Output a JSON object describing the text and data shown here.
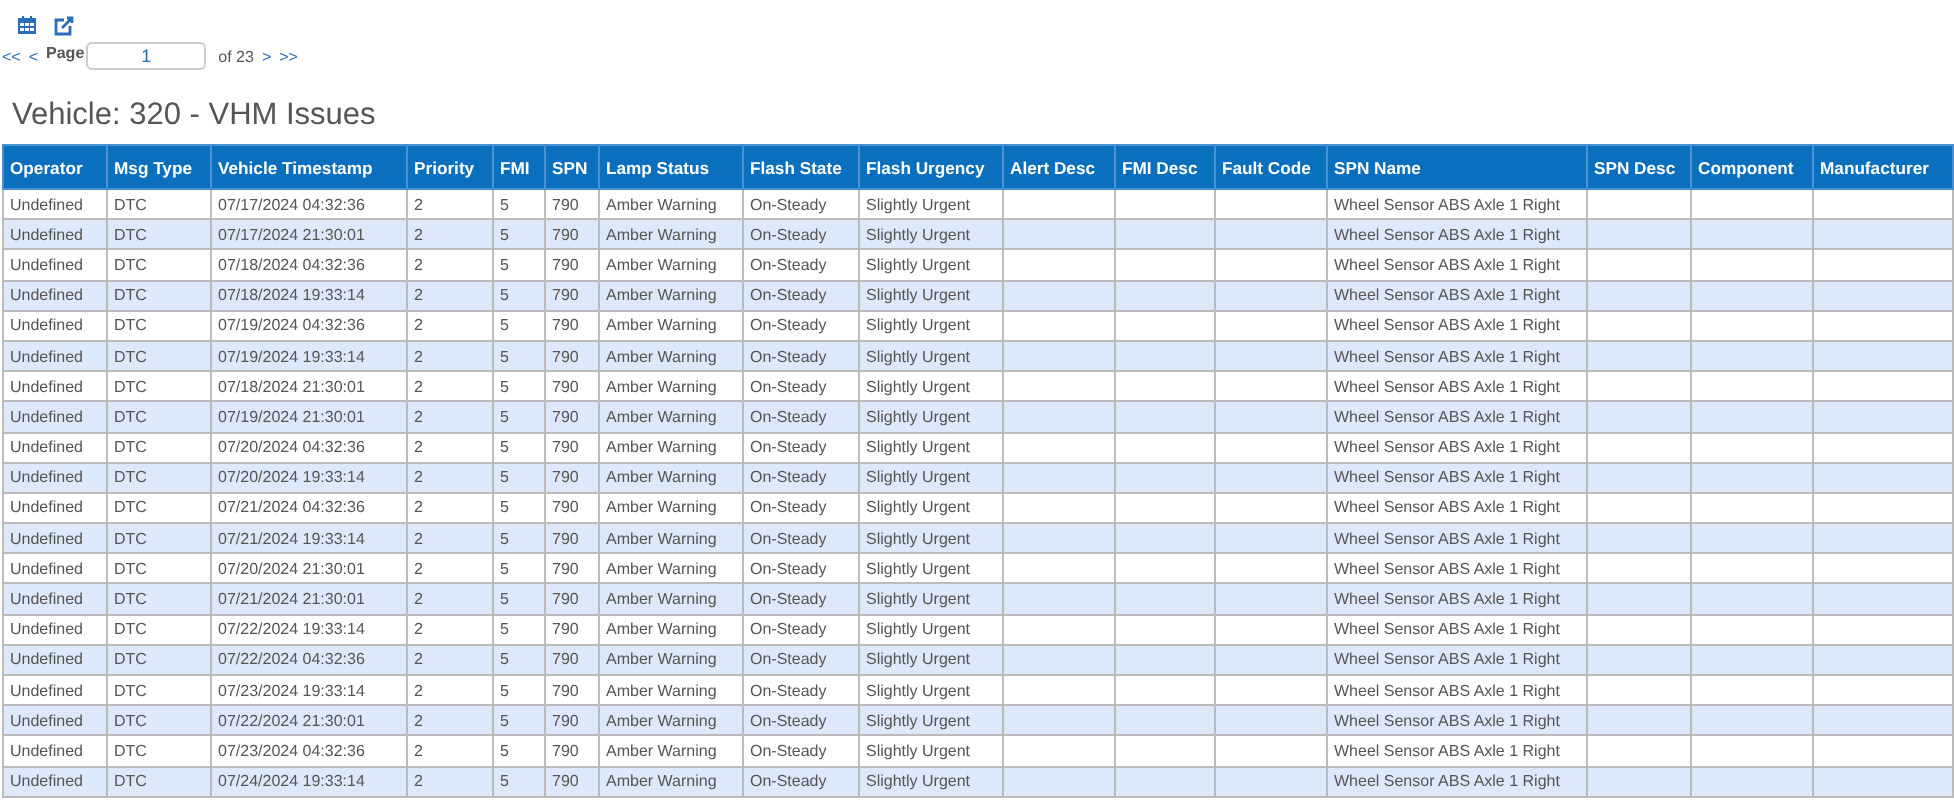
{
  "pager": {
    "first": "<<",
    "prev": "<",
    "label": "Page",
    "page": "1",
    "of": "of 23",
    "next": ">",
    "last": ">>"
  },
  "title": "Vehicle: 320 - VHM Issues",
  "table": {
    "columns": [
      "Operator",
      "Msg Type",
      "Vehicle Timestamp",
      "Priority",
      "FMI",
      "SPN",
      "Lamp Status",
      "Flash State",
      "Flash Urgency",
      "Alert Desc",
      "FMI Desc",
      "Fault Code",
      "SPN Name",
      "SPN Desc",
      "Component",
      "Manufacturer"
    ],
    "rows": [
      [
        "Undefined",
        "DTC",
        "07/17/2024 04:32:36",
        "2",
        "5",
        "790",
        "Amber Warning",
        "On-Steady",
        "Slightly Urgent",
        null,
        null,
        null,
        "Wheel Sensor ABS Axle 1 Right",
        null,
        null,
        null
      ],
      [
        "Undefined",
        "DTC",
        "07/17/2024 21:30:01",
        "2",
        "5",
        "790",
        "Amber Warning",
        "On-Steady",
        "Slightly Urgent",
        null,
        null,
        null,
        "Wheel Sensor ABS Axle 1 Right",
        null,
        null,
        null
      ],
      [
        "Undefined",
        "DTC",
        "07/18/2024 04:32:36",
        "2",
        "5",
        "790",
        "Amber Warning",
        "On-Steady",
        "Slightly Urgent",
        null,
        null,
        null,
        "Wheel Sensor ABS Axle 1 Right",
        null,
        null,
        null
      ],
      [
        "Undefined",
        "DTC",
        "07/18/2024 19:33:14",
        "2",
        "5",
        "790",
        "Amber Warning",
        "On-Steady",
        "Slightly Urgent",
        null,
        null,
        null,
        "Wheel Sensor ABS Axle 1 Right",
        null,
        null,
        null
      ],
      [
        "Undefined",
        "DTC",
        "07/19/2024 04:32:36",
        "2",
        "5",
        "790",
        "Amber Warning",
        "On-Steady",
        "Slightly Urgent",
        null,
        null,
        null,
        "Wheel Sensor ABS Axle 1 Right",
        null,
        null,
        null
      ],
      [
        "Undefined",
        "DTC",
        "07/19/2024 19:33:14",
        "2",
        "5",
        "790",
        "Amber Warning",
        "On-Steady",
        "Slightly Urgent",
        null,
        null,
        null,
        "Wheel Sensor ABS Axle 1 Right",
        null,
        null,
        null
      ],
      [
        "Undefined",
        "DTC",
        "07/18/2024 21:30:01",
        "2",
        "5",
        "790",
        "Amber Warning",
        "On-Steady",
        "Slightly Urgent",
        null,
        null,
        null,
        "Wheel Sensor ABS Axle 1 Right",
        null,
        null,
        null
      ],
      [
        "Undefined",
        "DTC",
        "07/19/2024 21:30:01",
        "2",
        "5",
        "790",
        "Amber Warning",
        "On-Steady",
        "Slightly Urgent",
        null,
        null,
        null,
        "Wheel Sensor ABS Axle 1 Right",
        null,
        null,
        null
      ],
      [
        "Undefined",
        "DTC",
        "07/20/2024 04:32:36",
        "2",
        "5",
        "790",
        "Amber Warning",
        "On-Steady",
        "Slightly Urgent",
        null,
        null,
        null,
        "Wheel Sensor ABS Axle 1 Right",
        null,
        null,
        null
      ],
      [
        "Undefined",
        "DTC",
        "07/20/2024 19:33:14",
        "2",
        "5",
        "790",
        "Amber Warning",
        "On-Steady",
        "Slightly Urgent",
        null,
        null,
        null,
        "Wheel Sensor ABS Axle 1 Right",
        null,
        null,
        null
      ],
      [
        "Undefined",
        "DTC",
        "07/21/2024 04:32:36",
        "2",
        "5",
        "790",
        "Amber Warning",
        "On-Steady",
        "Slightly Urgent",
        null,
        null,
        null,
        "Wheel Sensor ABS Axle 1 Right",
        null,
        null,
        null
      ],
      [
        "Undefined",
        "DTC",
        "07/21/2024 19:33:14",
        "2",
        "5",
        "790",
        "Amber Warning",
        "On-Steady",
        "Slightly Urgent",
        null,
        null,
        null,
        "Wheel Sensor ABS Axle 1 Right",
        null,
        null,
        null
      ],
      [
        "Undefined",
        "DTC",
        "07/20/2024 21:30:01",
        "2",
        "5",
        "790",
        "Amber Warning",
        "On-Steady",
        "Slightly Urgent",
        null,
        null,
        null,
        "Wheel Sensor ABS Axle 1 Right",
        null,
        null,
        null
      ],
      [
        "Undefined",
        "DTC",
        "07/21/2024 21:30:01",
        "2",
        "5",
        "790",
        "Amber Warning",
        "On-Steady",
        "Slightly Urgent",
        null,
        null,
        null,
        "Wheel Sensor ABS Axle 1 Right",
        null,
        null,
        null
      ],
      [
        "Undefined",
        "DTC",
        "07/22/2024 19:33:14",
        "2",
        "5",
        "790",
        "Amber Warning",
        "On-Steady",
        "Slightly Urgent",
        null,
        null,
        null,
        "Wheel Sensor ABS Axle 1 Right",
        null,
        null,
        null
      ],
      [
        "Undefined",
        "DTC",
        "07/22/2024 04:32:36",
        "2",
        "5",
        "790",
        "Amber Warning",
        "On-Steady",
        "Slightly Urgent",
        null,
        null,
        null,
        "Wheel Sensor ABS Axle 1 Right",
        null,
        null,
        null
      ],
      [
        "Undefined",
        "DTC",
        "07/23/2024 19:33:14",
        "2",
        "5",
        "790",
        "Amber Warning",
        "On-Steady",
        "Slightly Urgent",
        null,
        null,
        null,
        "Wheel Sensor ABS Axle 1 Right",
        null,
        null,
        null
      ],
      [
        "Undefined",
        "DTC",
        "07/22/2024 21:30:01",
        "2",
        "5",
        "790",
        "Amber Warning",
        "On-Steady",
        "Slightly Urgent",
        null,
        null,
        null,
        "Wheel Sensor ABS Axle 1 Right",
        null,
        null,
        null
      ],
      [
        "Undefined",
        "DTC",
        "07/23/2024 04:32:36",
        "2",
        "5",
        "790",
        "Amber Warning",
        "On-Steady",
        "Slightly Urgent",
        null,
        null,
        null,
        "Wheel Sensor ABS Axle 1 Right",
        null,
        null,
        null
      ],
      [
        "Undefined",
        "DTC",
        "07/24/2024 19:33:14",
        "2",
        "5",
        "790",
        "Amber Warning",
        "On-Steady",
        "Slightly Urgent",
        null,
        null,
        null,
        "Wheel Sensor ABS Axle 1 Right",
        null,
        null,
        null
      ]
    ]
  }
}
